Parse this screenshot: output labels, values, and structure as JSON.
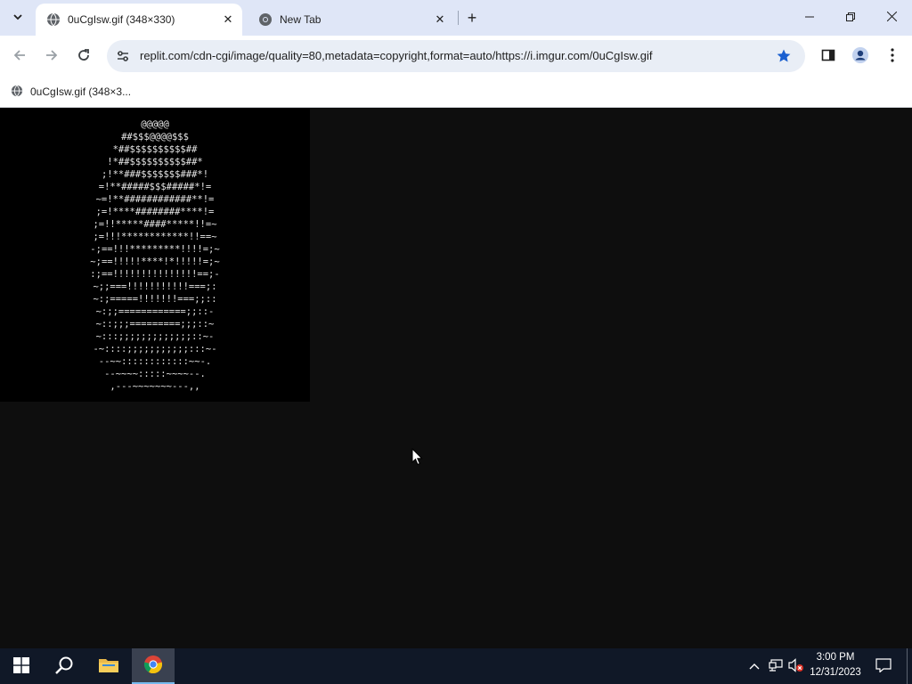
{
  "tabs": [
    {
      "title": "0uCgIsw.gif (348×330)",
      "active": true
    },
    {
      "title": "New Tab",
      "active": false
    }
  ],
  "toolbar": {
    "url": "replit.com/cdn-cgi/image/quality=80,metadata=copyright,format=auto/https://i.imgur.com/0uCgIsw.gif"
  },
  "bookmarks": [
    {
      "title": "0uCgIsw.gif (348×3..."
    }
  ],
  "content": {
    "ascii_art": "@@@@@\n##$$$@@@@$$$\n*##$$$$$$$$$$##\n!*##$$$$$$$$$$##*\n;!**###$$$$$$$###*!\n=!**#####$$$#####*!=\n~=!**############**!=\n;=!****########****!=\n;=!!*****####*****!!=~\n;=!!!************!!==~\n-;==!!!*********!!!!=;~\n~;==!!!!!****!*!!!!!=;~\n:;==!!!!!!!!!!!!!!!==;-\n~;;===!!!!!!!!!!!===;:\n~:;=====!!!!!!!===;;::\n~:;;============;;::-\n~::;;;=========;;;::~\n~:::;;;;;;;;;;;;;::~-\n-~::::;;;;;;;;;;;:::~-\n--~~::::::::::::~~-.\n--~~~~:::::~~~~--.\n,---~~~~~~~---,,"
  },
  "taskbar": {
    "time": "3:00 PM",
    "date": "12/31/2023"
  },
  "colors": {
    "tabstrip": "#dfe6f7",
    "omnibox": "#e9eef6",
    "star": "#1a5fd0",
    "taskbar": "#101827",
    "page_bg": "#0e0e0e"
  }
}
